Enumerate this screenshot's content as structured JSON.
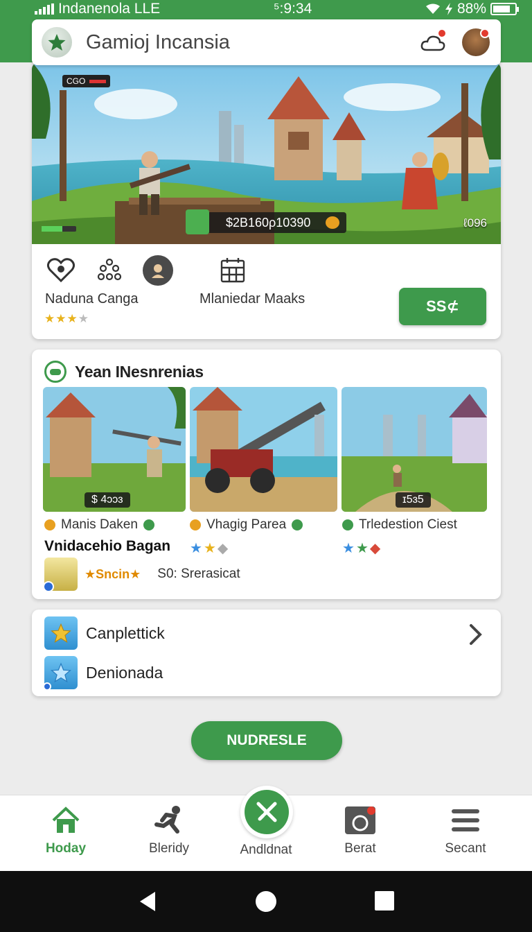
{
  "status_bar": {
    "carrier": "Indanenola  LLE",
    "time": "⁵:9:34",
    "battery": "88%"
  },
  "header": {
    "title": "Gamioj Incansia"
  },
  "hero": {
    "hud_label": "CGO",
    "money": "$2B160ρ10390",
    "count": "ℓ096",
    "label_left": "Naduna Canga",
    "label_right": "Mlaniedar Maaks",
    "rating": 3,
    "button_label": "SS⊄"
  },
  "featured": {
    "title": "Yean INesnrenias",
    "games": [
      {
        "price": "$ 4ɔɔɜ",
        "name": "Manis Daken"
      },
      {
        "price": "",
        "name": "Vhaɡig Parea"
      },
      {
        "price": "ɪ5ɜ5",
        "name": "Trledestion Ciest"
      }
    ],
    "subtitle": "Vnidacehio Bagan",
    "promo_label": "Sncin",
    "promo_text": "S0: Srerasicat"
  },
  "list": {
    "items": [
      {
        "label": "Canplettick"
      },
      {
        "label": "Denionada"
      }
    ]
  },
  "cta": {
    "label": "NUDRESLE"
  },
  "bottom_nav": {
    "items": [
      {
        "label": "Hoday"
      },
      {
        "label": "Bleridy"
      },
      {
        "label": "Andldnat"
      },
      {
        "label": "Berat"
      },
      {
        "label": "Secant"
      }
    ]
  },
  "colors": {
    "brand_green": "#3e9a4c",
    "status_bar": "#3f9a4c",
    "background": "#ececec",
    "star_gold": "#e8b21c"
  }
}
